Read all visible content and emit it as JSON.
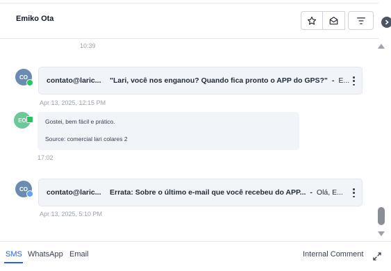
{
  "header": {
    "contact_name": "Emiko Ota"
  },
  "icons": {
    "star": "star-icon",
    "mail": "mail-open-icon",
    "filter": "filter-icon",
    "collapse": "chevron-right-icon"
  },
  "thread": {
    "first_time": "10:39",
    "messages": [
      {
        "avatar": "CO",
        "from": "contato@laric...",
        "subject": "\"Lari, você nos enganou? Quando fica pronto o APP do GPS?\"",
        "separator": "-",
        "preview": "E...",
        "timestamp": "Apr 13, 2025, 12:15 PM"
      },
      {
        "avatar": "EO",
        "line1": "Gostei, bem fácil e prático.",
        "line2": "Source: comercial lari colares 2",
        "timestamp": "17:02"
      },
      {
        "avatar": "CO",
        "from": "contato@laric...",
        "subject": "Errata: Sobre o último e-mail que você recebeu do APP...",
        "separator": "-",
        "preview": "Olá, E...",
        "timestamp": "Apr 13, 2025, 5:10 PM"
      }
    ]
  },
  "footer": {
    "tabs": [
      "SMS",
      "WhatsApp",
      "Email"
    ],
    "active_tab": "SMS",
    "internal_comment": "Internal Comment"
  },
  "colors": {
    "accent": "#2563eb",
    "avatar_co": "#6b8bb0",
    "avatar_eo": "#6cc79a",
    "badge_green": "#22c55e",
    "badge_blue": "#60a5fa"
  }
}
